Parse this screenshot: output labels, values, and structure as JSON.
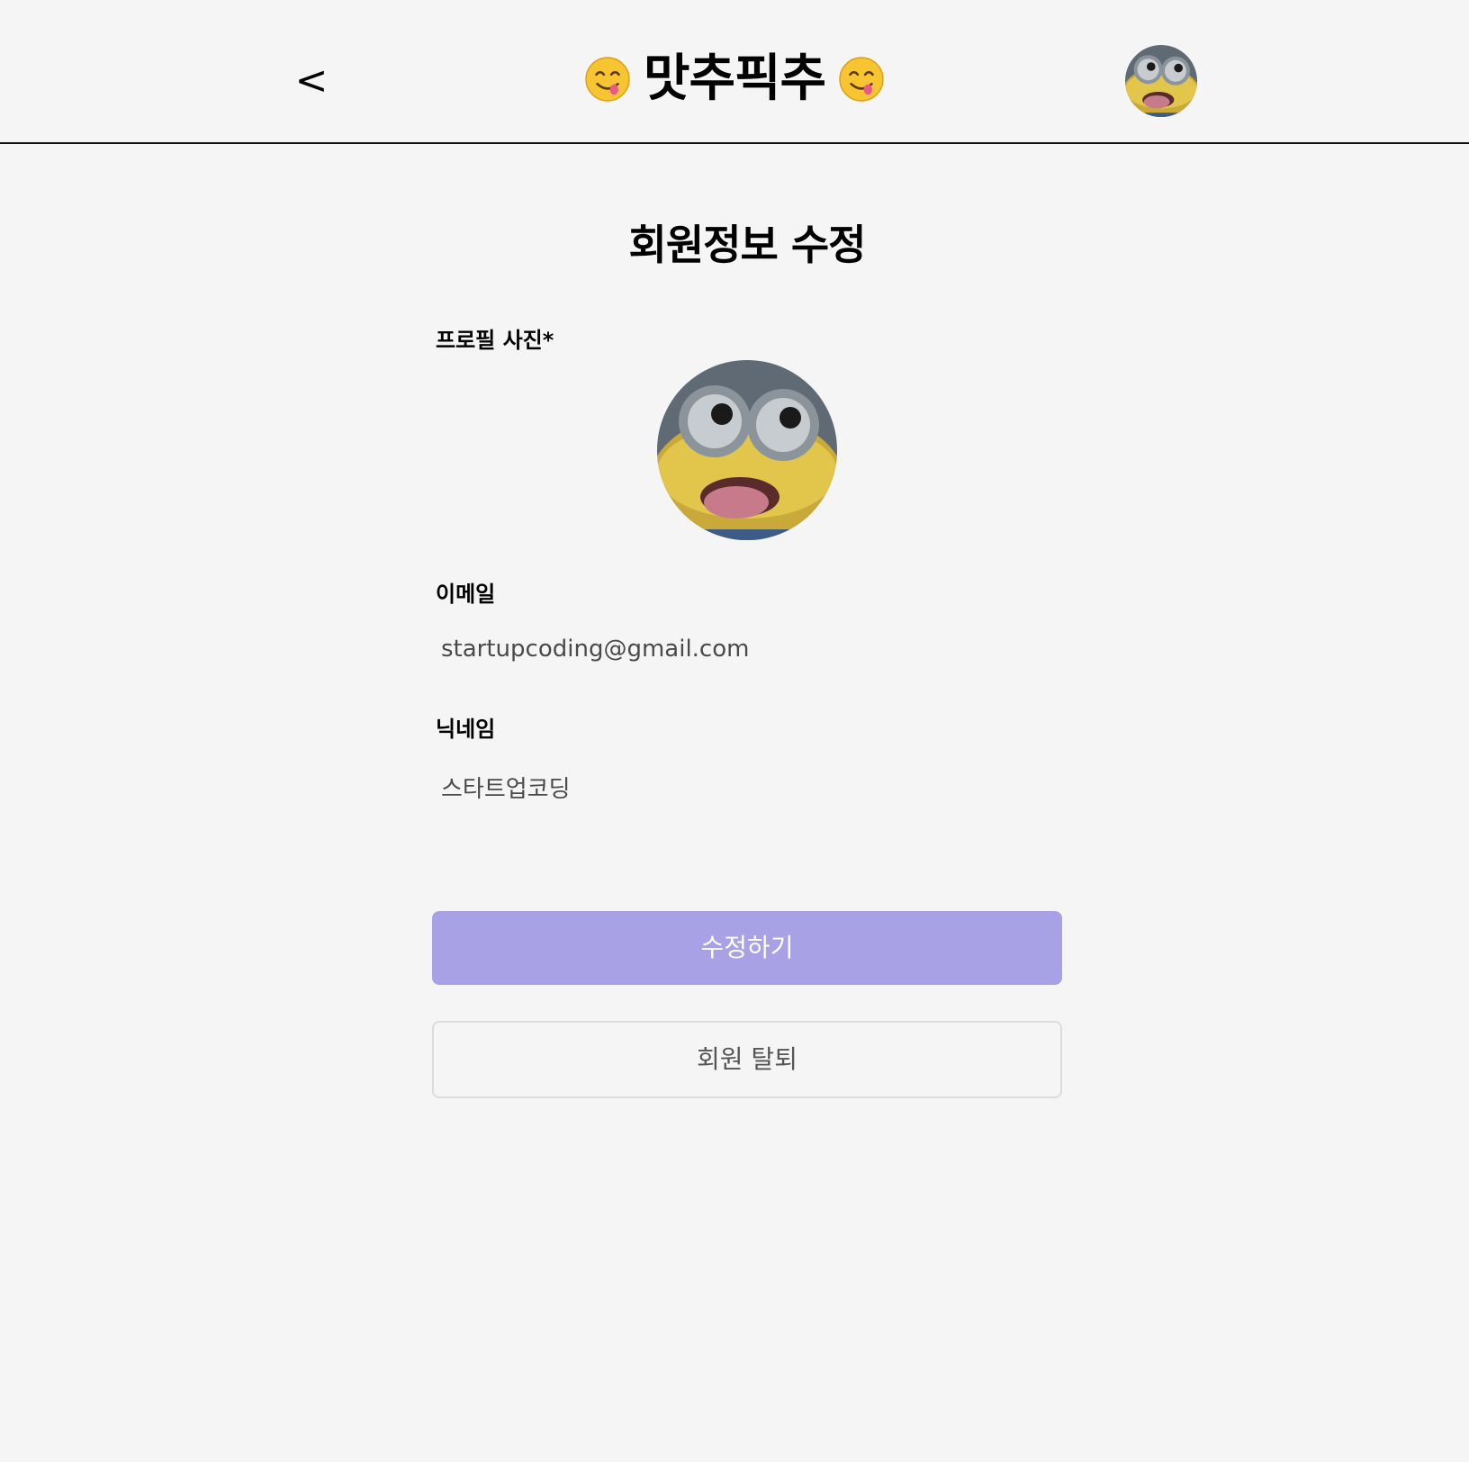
{
  "header": {
    "back_label": "<",
    "brand_title": "맛추픽추",
    "left_emoji_icon": "savoring-face-emoji",
    "right_emoji_icon": "savoring-face-emoji",
    "avatar_icon": "user-avatar"
  },
  "page": {
    "title": "회원정보 수정"
  },
  "form": {
    "profile_photo_label": "프로필 사진*",
    "email_label": "이메일",
    "email_value": "startupcoding@gmail.com",
    "nickname_label": "닉네임",
    "nickname_value": "스타트업코딩"
  },
  "actions": {
    "submit_label": "수정하기",
    "withdraw_label": "회원 탈퇴"
  },
  "colors": {
    "background": "#f5f5f5",
    "primary_button": "#a9a1e5",
    "secondary_border": "#dcdcdc",
    "value_text": "#4a4a4a"
  }
}
